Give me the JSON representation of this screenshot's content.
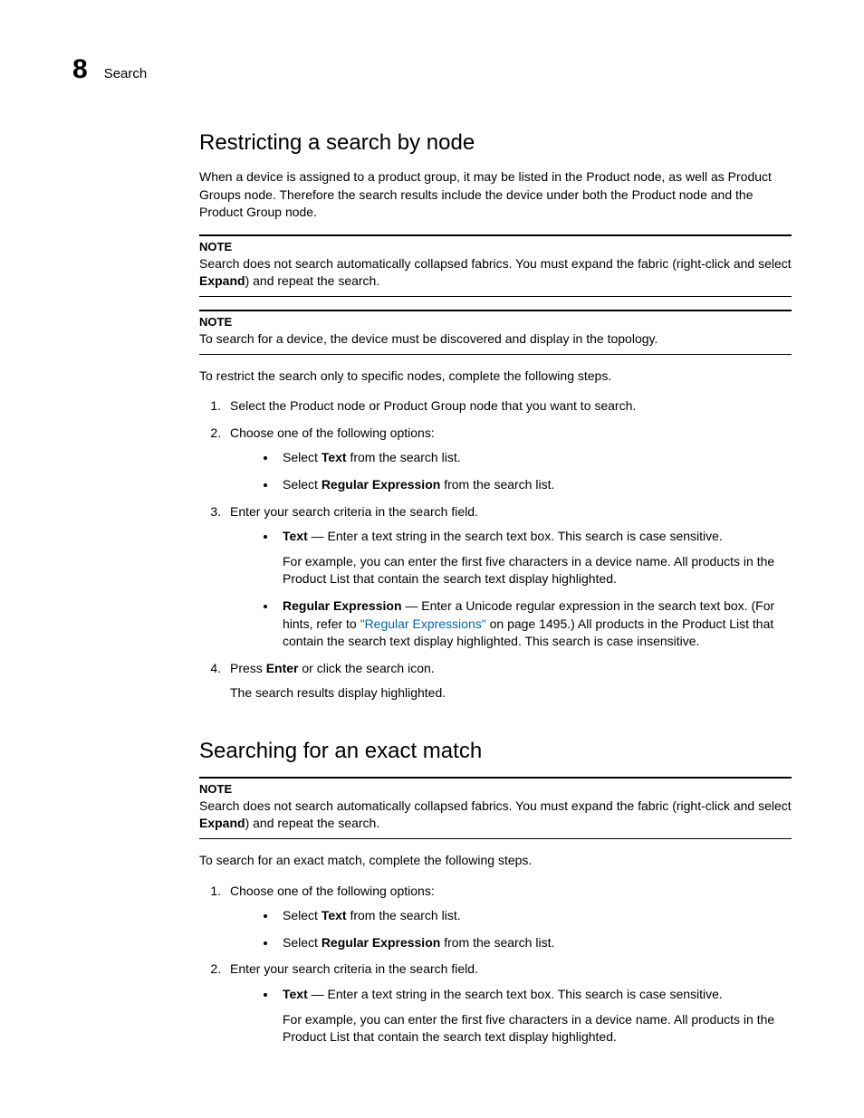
{
  "header": {
    "chapterNumber": "8",
    "chapterName": "Search"
  },
  "section1": {
    "title": "Restricting a search by node",
    "intro": "When a device is assigned to a product group, it may be listed in the Product node, as well as Product Groups node. Therefore the search results include the device under both the Product node and the Product Group node.",
    "note1": {
      "label": "NOTE",
      "pre": "Search does not search automatically collapsed fabrics. You must expand the fabric (right-click and select ",
      "bold": "Expand",
      "post": ") and repeat the search."
    },
    "note2": {
      "label": "NOTE",
      "text": "To search for a device, the device must be discovered and display in the topology."
    },
    "lead": "To restrict the search only to specific nodes, complete the following steps.",
    "step1": "Select the Product node or Product Group node that you want to search.",
    "step2": "Choose one of the following options:",
    "step2a": {
      "pre": "Select ",
      "bold": "Text",
      "post": " from the search list."
    },
    "step2b": {
      "pre": "Select ",
      "bold": "Regular Expression",
      "post": " from the search list."
    },
    "step3": "Enter your search criteria in the search field.",
    "step3a": {
      "bold": "Text",
      "post": " — Enter a text string in the search text box. This search is case sensitive.",
      "para": "For example, you can enter the first five characters in a device name. All products in the Product List that contain the search text display highlighted."
    },
    "step3b": {
      "bold": "Regular Expression",
      "post1": " — Enter a Unicode regular expression in the search text box. (For hints, refer to ",
      "link": "\"Regular Expressions\"",
      "post2": " on page 1495.) All products in the Product List that contain the search text display highlighted. This search is case insensitive."
    },
    "step4": {
      "pre": "Press ",
      "bold": "Enter",
      "post": " or click the search icon."
    },
    "step4para": "The search results display highlighted."
  },
  "section2": {
    "title": "Searching for an exact match",
    "note": {
      "label": "NOTE",
      "pre": "Search does not search automatically collapsed fabrics. You must expand the fabric (right-click and select ",
      "bold": "Expand",
      "post": ") and repeat the search."
    },
    "lead": "To search for an exact match, complete the following steps.",
    "step1": "Choose one of the following options:",
    "step1a": {
      "pre": "Select ",
      "bold": "Text",
      "post": " from the search list."
    },
    "step1b": {
      "pre": "Select ",
      "bold": "Regular Expression",
      "post": " from the search list."
    },
    "step2": "Enter your search criteria in the search field.",
    "step2a": {
      "bold": "Text",
      "post": " — Enter a text string in the search text box. This search is case sensitive.",
      "para": "For example, you can enter the first five characters in a device name. All products in the Product List that contain the search text display highlighted."
    }
  }
}
